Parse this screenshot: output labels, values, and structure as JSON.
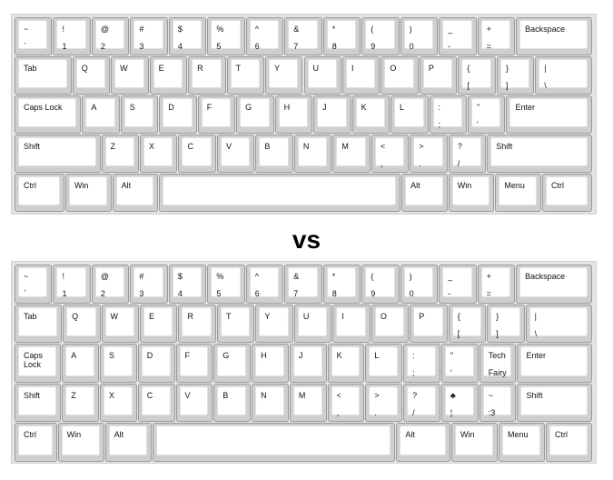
{
  "separator": "vs",
  "keyboards": [
    {
      "name": "standard",
      "rows": [
        [
          {
            "t": "~",
            "b": "`"
          },
          {
            "t": "!",
            "b": "1"
          },
          {
            "t": "@",
            "b": "2"
          },
          {
            "t": "#",
            "b": "3"
          },
          {
            "t": "$",
            "b": "4"
          },
          {
            "t": "%",
            "b": "5"
          },
          {
            "t": "^",
            "b": "6"
          },
          {
            "t": "&",
            "b": "7"
          },
          {
            "t": "*",
            "b": "8"
          },
          {
            "t": "(",
            "b": "9"
          },
          {
            "t": ")",
            "b": "0"
          },
          {
            "t": "_",
            "b": "-"
          },
          {
            "t": "+",
            "b": "="
          },
          {
            "t": "Backspace",
            "b": ""
          }
        ],
        [
          {
            "t": "Tab",
            "b": ""
          },
          {
            "t": "Q",
            "b": ""
          },
          {
            "t": "W",
            "b": ""
          },
          {
            "t": "E",
            "b": ""
          },
          {
            "t": "R",
            "b": ""
          },
          {
            "t": "T",
            "b": ""
          },
          {
            "t": "Y",
            "b": ""
          },
          {
            "t": "U",
            "b": ""
          },
          {
            "t": "I",
            "b": ""
          },
          {
            "t": "O",
            "b": ""
          },
          {
            "t": "P",
            "b": ""
          },
          {
            "t": "{",
            "b": "["
          },
          {
            "t": "}",
            "b": "]"
          },
          {
            "t": "|",
            "b": "\\"
          }
        ],
        [
          {
            "t": "Caps Lock",
            "b": ""
          },
          {
            "t": "A",
            "b": ""
          },
          {
            "t": "S",
            "b": ""
          },
          {
            "t": "D",
            "b": ""
          },
          {
            "t": "F",
            "b": ""
          },
          {
            "t": "G",
            "b": ""
          },
          {
            "t": "H",
            "b": ""
          },
          {
            "t": "J",
            "b": ""
          },
          {
            "t": "K",
            "b": ""
          },
          {
            "t": "L",
            "b": ""
          },
          {
            "t": ":",
            "b": ";"
          },
          {
            "t": "\"",
            "b": "'"
          },
          {
            "t": "Enter",
            "b": ""
          }
        ],
        [
          {
            "t": "Shift",
            "b": ""
          },
          {
            "t": "Z",
            "b": ""
          },
          {
            "t": "X",
            "b": ""
          },
          {
            "t": "C",
            "b": ""
          },
          {
            "t": "V",
            "b": ""
          },
          {
            "t": "B",
            "b": ""
          },
          {
            "t": "N",
            "b": ""
          },
          {
            "t": "M",
            "b": ""
          },
          {
            "t": "<",
            "b": ","
          },
          {
            "t": ">",
            "b": "."
          },
          {
            "t": "?",
            "b": "/"
          },
          {
            "t": "Shift",
            "b": ""
          }
        ],
        [
          {
            "t": "Ctrl",
            "b": ""
          },
          {
            "t": "Win",
            "b": ""
          },
          {
            "t": "Alt",
            "b": ""
          },
          {
            "t": "",
            "b": ""
          },
          {
            "t": "Alt",
            "b": ""
          },
          {
            "t": "Win",
            "b": ""
          },
          {
            "t": "Menu",
            "b": ""
          },
          {
            "t": "Ctrl",
            "b": ""
          }
        ]
      ]
    },
    {
      "name": "custom",
      "rows": [
        [
          {
            "t": "~",
            "b": "`"
          },
          {
            "t": "!",
            "b": "1"
          },
          {
            "t": "@",
            "b": "2"
          },
          {
            "t": "#",
            "b": "3"
          },
          {
            "t": "$",
            "b": "4"
          },
          {
            "t": "%",
            "b": "5"
          },
          {
            "t": "^",
            "b": "6"
          },
          {
            "t": "&",
            "b": "7"
          },
          {
            "t": "*",
            "b": "8"
          },
          {
            "t": "(",
            "b": "9"
          },
          {
            "t": ")",
            "b": "0"
          },
          {
            "t": "_",
            "b": "-"
          },
          {
            "t": "+",
            "b": "="
          },
          {
            "t": "Backspace",
            "b": ""
          }
        ],
        [
          {
            "t": "Tab",
            "b": ""
          },
          {
            "t": "Q",
            "b": ""
          },
          {
            "t": "W",
            "b": ""
          },
          {
            "t": "E",
            "b": ""
          },
          {
            "t": "R",
            "b": ""
          },
          {
            "t": "T",
            "b": ""
          },
          {
            "t": "Y",
            "b": ""
          },
          {
            "t": "U",
            "b": ""
          },
          {
            "t": "I",
            "b": ""
          },
          {
            "t": "O",
            "b": ""
          },
          {
            "t": "P",
            "b": ""
          },
          {
            "t": "{",
            "b": "["
          },
          {
            "t": "}",
            "b": "]"
          },
          {
            "t": "|",
            "b": "\\"
          }
        ],
        [
          {
            "t": "Caps\nLock",
            "b": ""
          },
          {
            "t": "A",
            "b": ""
          },
          {
            "t": "S",
            "b": ""
          },
          {
            "t": "D",
            "b": ""
          },
          {
            "t": "F",
            "b": ""
          },
          {
            "t": "G",
            "b": ""
          },
          {
            "t": "H",
            "b": ""
          },
          {
            "t": "J",
            "b": ""
          },
          {
            "t": "K",
            "b": ""
          },
          {
            "t": "L",
            "b": ""
          },
          {
            "t": ":",
            "b": ";"
          },
          {
            "t": "\"",
            "b": "'"
          },
          {
            "t": "Tech",
            "b": "Fairy"
          },
          {
            "t": "Enter",
            "b": ""
          }
        ],
        [
          {
            "t": "Shift",
            "b": ""
          },
          {
            "t": "Z",
            "b": ""
          },
          {
            "t": "X",
            "b": ""
          },
          {
            "t": "C",
            "b": ""
          },
          {
            "t": "V",
            "b": ""
          },
          {
            "t": "B",
            "b": ""
          },
          {
            "t": "N",
            "b": ""
          },
          {
            "t": "M",
            "b": ""
          },
          {
            "t": "<",
            "b": ","
          },
          {
            "t": ">",
            "b": "."
          },
          {
            "t": "?",
            "b": "/"
          },
          {
            "t": "♣",
            "b": "¦"
          },
          {
            "t": "~",
            "b": ":3"
          },
          {
            "t": "Shift",
            "b": ""
          }
        ],
        [
          {
            "t": "Ctrl",
            "b": ""
          },
          {
            "t": "Win",
            "b": ""
          },
          {
            "t": "Alt",
            "b": ""
          },
          {
            "t": "",
            "b": ""
          },
          {
            "t": "Alt",
            "b": ""
          },
          {
            "t": "Win",
            "b": ""
          },
          {
            "t": "Menu",
            "b": ""
          },
          {
            "t": "Ctrl",
            "b": ""
          }
        ]
      ]
    }
  ]
}
